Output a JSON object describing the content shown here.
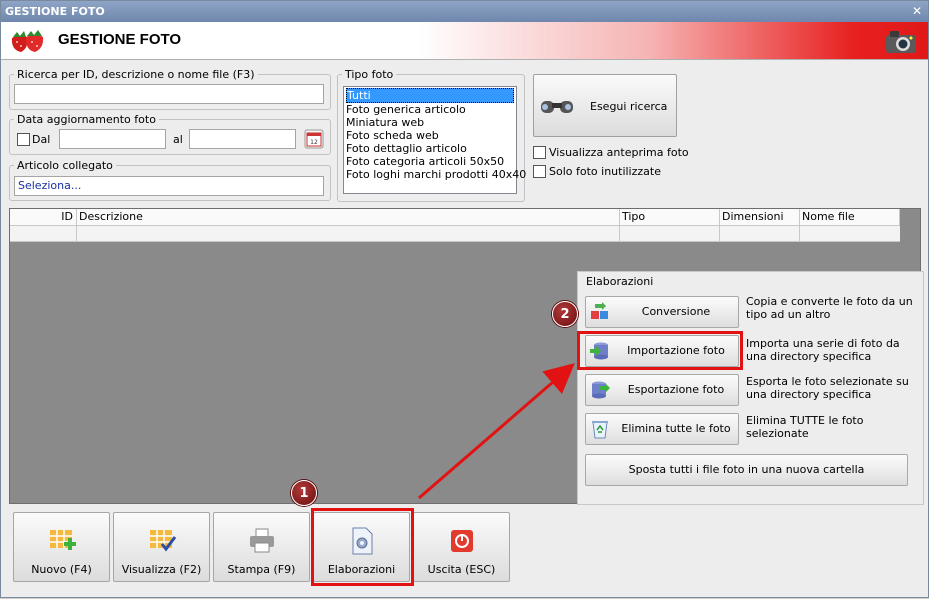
{
  "window": {
    "title": "GESTIONE FOTO",
    "close": "✕"
  },
  "header": {
    "title": "GESTIONE FOTO"
  },
  "search": {
    "id_label": "Ricerca per ID, descrizione o nome file (F3)",
    "id_value": "",
    "date_group_label": "Data aggiornamento foto",
    "dal_label": "Dal",
    "al_label": "al",
    "article_group_label": "Articolo collegato",
    "article_value": "Seleziona...",
    "tipo_label": "Tipo foto",
    "tipo_options": [
      "Tutti",
      "Foto generica articolo",
      "Miniatura web",
      "Foto scheda web",
      "Foto dettaglio articolo",
      "Foto categoria articoli 50x50",
      "Foto loghi marchi prodotti 40x40"
    ],
    "tipo_selected": "Tutti",
    "run_label": "Esegui ricerca",
    "preview_label": "Visualizza anteprima foto",
    "unused_label": "Solo foto inutilizzate"
  },
  "grid": {
    "columns": [
      "ID",
      "Descrizione",
      "Tipo",
      "Dimensioni",
      "Nome file"
    ]
  },
  "elaborazioni": {
    "title": "Elaborazioni",
    "items": [
      {
        "label": "Conversione",
        "desc": "Copia e converte le foto da un tipo ad un altro",
        "icon": "convert-icon"
      },
      {
        "label": "Importazione foto",
        "desc": "Importa una serie di foto da una directory specifica",
        "icon": "import-icon"
      },
      {
        "label": "Esportazione foto",
        "desc": "Esporta le foto selezionate su una directory specifica",
        "icon": "export-icon"
      },
      {
        "label": "Elimina tutte le foto",
        "desc": "Elimina TUTTE le foto selezionate",
        "icon": "recycle-bin-icon"
      }
    ],
    "move_label": "Sposta tutti i file foto in una nuova cartella"
  },
  "toolbar": {
    "new_label": "Nuovo (F4)",
    "view_label": "Visualizza (F2)",
    "print_label": "Stampa (F9)",
    "process_label": "Elaborazioni",
    "exit_label": "Uscita (ESC)"
  },
  "annotations": {
    "badge1": "1",
    "badge2": "2"
  },
  "colors": {
    "highlight": "#e21212",
    "header_red": "#e01818",
    "selection": "#3399ff"
  }
}
